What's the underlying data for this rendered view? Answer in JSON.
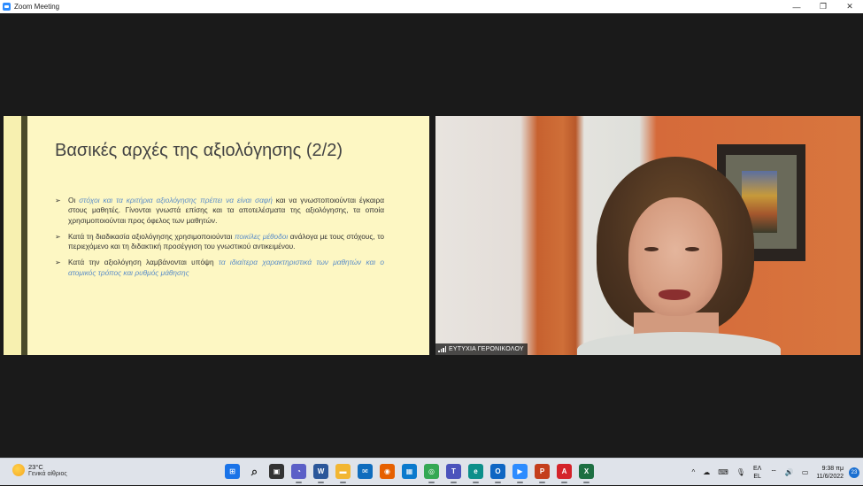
{
  "window": {
    "title": "Zoom Meeting",
    "controls": {
      "minimize": "—",
      "restore": "❐",
      "close": "✕"
    }
  },
  "slide": {
    "title": "Βασικές αρχές της αξιολόγησης (2/2)",
    "bullets": [
      {
        "pre": "Οι ",
        "emph": "στόχοι και τα κριτήρια αξιολόγησης πρέπει να είναι σαφή",
        "post": " και να γνωστοποιούνται έγκαιρα στους μαθητές. Γίνονται γνωστά επίσης και τα αποτελέσματα της αξιολόγησης, τα οποία χρησιμοποιούνται προς όφελος των μαθητών."
      },
      {
        "pre": "Κατά τη διαδικασία αξιολόγησης χρησιμοποιούνται ",
        "emph": "ποικίλες μέθοδοι",
        "post": " ανάλογα με τους στόχους, το περιεχόμενο και τη διδακτική προσέγγιση του γνωστικού αντικειμένου."
      },
      {
        "pre": "Κατά την αξιολόγηση λαμβάνονται υπόψη ",
        "emph": "τα ιδιαίτερα χαρακτηριστικά των μαθητών και ο ατομικός τρόπος και ρυθμός μάθησης",
        "post": ""
      }
    ],
    "bullet_glyph": "➢",
    "colors": {
      "background": "#fdf7c3",
      "accent_bar": "#4a4a2a",
      "emphasis": "#5b8dc8"
    }
  },
  "video": {
    "participant_name": "ΕΥΤΥΧΙΑ ΓΕΡΟΝΙΚΟΛΟΥ",
    "signal_icon": "signal-bars-icon"
  },
  "taskbar": {
    "weather": {
      "temperature": "23°C",
      "description": "Γενικά αίθριος",
      "icon": "sun-icon"
    },
    "apps": [
      {
        "name": "windows-start-icon",
        "color": "#1a73e8",
        "glyph": "⊞"
      },
      {
        "name": "search-icon",
        "color": "transparent",
        "glyph": "⌕"
      },
      {
        "name": "task-view-icon",
        "color": "#333333",
        "glyph": "▣"
      },
      {
        "name": "teams-chat-icon",
        "color": "#5b5fc7",
        "glyph": "◔"
      },
      {
        "name": "word-icon",
        "color": "#2b579a",
        "glyph": "W"
      },
      {
        "name": "file-explorer-icon",
        "color": "#f2b632",
        "glyph": "▬"
      },
      {
        "name": "mail-icon",
        "color": "#0f6cbd",
        "glyph": "✉"
      },
      {
        "name": "firefox-icon",
        "color": "#e66000",
        "glyph": "◉"
      },
      {
        "name": "store-icon",
        "color": "#0a7acd",
        "glyph": "▦"
      },
      {
        "name": "chrome-icon",
        "color": "#34a853",
        "glyph": "◎"
      },
      {
        "name": "teams-icon",
        "color": "#4b53bc",
        "glyph": "T"
      },
      {
        "name": "edge-icon",
        "color": "#0c8f8a",
        "glyph": "e"
      },
      {
        "name": "outlook-icon",
        "color": "#0f66c3",
        "glyph": "O"
      },
      {
        "name": "zoom-icon",
        "color": "#2d8cff",
        "glyph": "▶"
      },
      {
        "name": "powerpoint-icon",
        "color": "#c43e1c",
        "glyph": "P"
      },
      {
        "name": "acrobat-icon",
        "color": "#d4232a",
        "glyph": "A"
      },
      {
        "name": "excel-icon",
        "color": "#1d6f42",
        "glyph": "X"
      }
    ],
    "tray": {
      "chevron": "^",
      "language_top": "ΕΛ",
      "language_bottom": "EL",
      "time": "9:38 πμ",
      "date": "11/6/2022",
      "notifications": "23"
    }
  }
}
